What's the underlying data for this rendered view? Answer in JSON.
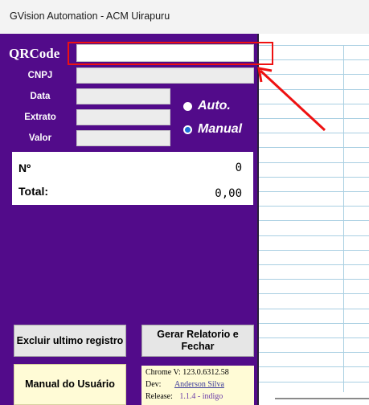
{
  "window": {
    "title": "GVision Automation - ACM Uirapuru"
  },
  "form": {
    "qrcode_label": "QRCode",
    "qrcode_value": "",
    "cnpj_label": "CNPJ",
    "data_label": "Data",
    "extrato_label": "Extrato",
    "valor_label": "Valor"
  },
  "mode": {
    "auto_label": "Auto.",
    "manual_label": "Manual",
    "selected": "Manual"
  },
  "counter": {
    "n_label": "Nº",
    "n_value": "0",
    "total_label": "Total:",
    "total_value": "0,00"
  },
  "buttons": {
    "delete_last": "Excluir ultimo registro",
    "report_close": "Gerar Relatorio e Fechar",
    "manual": "Manual do Usuário"
  },
  "info": {
    "chrome_label": "Chrome V:",
    "chrome_version": "123.0.6312.58",
    "dev_label": "Dev:",
    "dev_name": "Anderson Silva",
    "release_label": "Release:",
    "release_value": "1.1.4 - indigo"
  },
  "colors": {
    "panel": "#520b8a",
    "highlight": "#ee1111",
    "button": "#e6e6e6",
    "yellow_panel": "#fffbd6",
    "grid_line": "#a9cfe2"
  }
}
